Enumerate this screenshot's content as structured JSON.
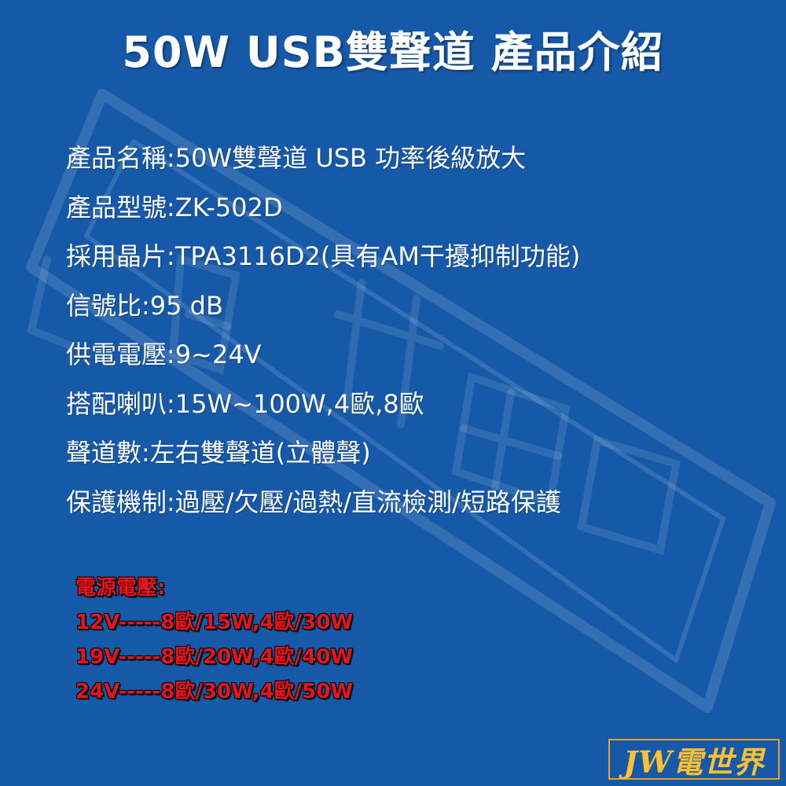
{
  "title": "50W USB雙聲道 產品介紹",
  "specs": [
    "產品名稱:50W雙聲道 USB 功率後級放大",
    "產品型號:ZK-502D",
    "採用晶片:TPA3116D2(具有AM干擾抑制功能)",
    "信號比:95 dB",
    "供電電壓:9~24V",
    "搭配喇叭:15W~100W,4歐,8歐",
    "聲道數:左右雙聲道(立體聲)",
    "保護機制:過壓/欠壓/過熱/直流檢測/短路保護"
  ],
  "power": {
    "heading": "電源電壓:",
    "rows": [
      "12V-----8歐/15W,4歐/30W",
      "19V-----8歐/20W,4歐/40W",
      "24V-----8歐/30W,4歐/50W"
    ]
  },
  "logo": {
    "text": "JW電世界"
  },
  "colors": {
    "background": "#1659a8",
    "text": "#ffffff",
    "power_text": "#e8141c",
    "logo": "#f0a020"
  }
}
